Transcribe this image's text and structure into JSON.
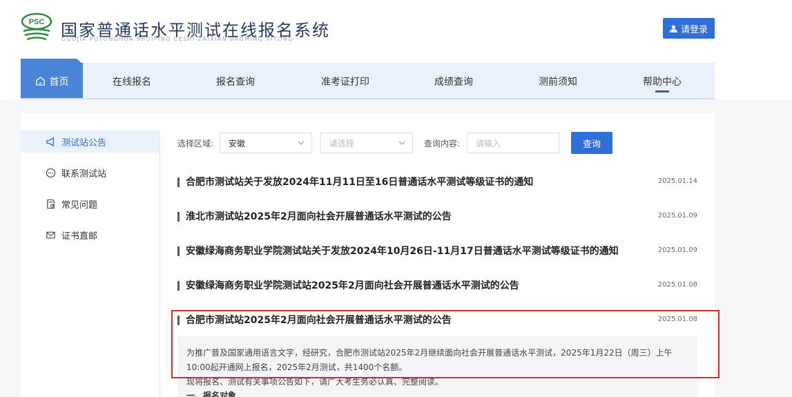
{
  "header": {
    "logo_text": "PSC",
    "title": "国家普通话水平测试在线报名系统",
    "subtitle": "GUOJIA PUTONGHUA SHUIPING CESHI ZAIXIAN BAOMING XITONG",
    "login_label": "请登录"
  },
  "nav": {
    "items": [
      {
        "label": "首页",
        "icon": "home-icon"
      },
      {
        "label": "在线报名"
      },
      {
        "label": "报名查询"
      },
      {
        "label": "准考证打印"
      },
      {
        "label": "成绩查询"
      },
      {
        "label": "测前须知"
      },
      {
        "label": "帮助中心"
      }
    ],
    "active_index": 6
  },
  "sidebar": {
    "items": [
      {
        "label": "测试站公告",
        "icon": "megaphone-icon"
      },
      {
        "label": "联系测试站",
        "icon": "chat-icon"
      },
      {
        "label": "常见问题",
        "icon": "question-doc-icon"
      },
      {
        "label": "证书直邮",
        "icon": "mail-icon"
      }
    ],
    "active_index": 0
  },
  "filter": {
    "region_label": "选择区域:",
    "province_value": "安徽",
    "city_placeholder": "请选择",
    "query_label": "查询内容:",
    "query_placeholder": "请输入",
    "search_button": "查询"
  },
  "notices": [
    {
      "title": "合肥市测试站关于发放2024年11月11日至16日普通话水平测试等级证书的通知",
      "date": "2025.01.14"
    },
    {
      "title": "淮北市测试站2025年2月面向社会开展普通话水平测试的公告",
      "date": "2025.01.09"
    },
    {
      "title": "安徽绿海商务职业学院测试站关于发放2024年10月26日-11月17日普通话水平测试等级证书的通知",
      "date": "2025.01.09"
    },
    {
      "title": "安徽绿海商务职业学院测试站2025年2月面向社会开展普通话水平测试的公告",
      "date": "2025.01.08"
    },
    {
      "title": "合肥市测试站2025年2月面向社会开展普通话水平测试的公告",
      "date": "2025.01.08"
    }
  ],
  "detail": {
    "paragraph1": "为推广普及国家通用语言文字，经研究，合肥市测试站2025年2月继续面向社会开展普通话水平测试，2025年1月22日（周三）上午10:00起开通网上报名，2025年2月测试，共1400个名额。",
    "paragraph2": "现将报名、测试有关事项公告如下，请广大考生务必认真、完整阅读。",
    "section1": "一、报名对象"
  },
  "colors": {
    "primary": "#2f6fd8",
    "nav_bg": "#e9f2fb",
    "highlight": "#d92a2a"
  }
}
